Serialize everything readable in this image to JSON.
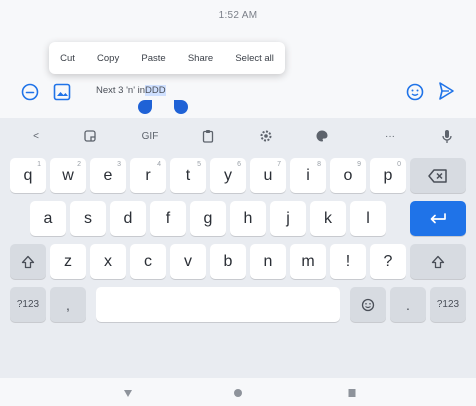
{
  "status": {
    "time": "1:52 AM"
  },
  "context_menu": {
    "items": [
      "Cut",
      "Copy",
      "Paste",
      "Share",
      "Select all"
    ]
  },
  "ghost_text": "",
  "compose": {
    "text_before": "Next 3 'n' in",
    "selected": "DDD",
    "text_after": ""
  },
  "toolbar": {
    "items": [
      {
        "name": "back-icon",
        "label": "<"
      },
      {
        "name": "sticker-icon",
        "label": ""
      },
      {
        "name": "gif-icon",
        "label": "GIF"
      },
      {
        "name": "clipboard-icon",
        "label": ""
      },
      {
        "name": "settings-icon",
        "label": ""
      },
      {
        "name": "palette-icon",
        "label": ""
      },
      {
        "name": "more-icon",
        "label": "···"
      },
      {
        "name": "mic-icon",
        "label": ""
      }
    ]
  },
  "keys": {
    "row1": [
      {
        "c": "q",
        "h": "1"
      },
      {
        "c": "w",
        "h": "2"
      },
      {
        "c": "e",
        "h": "3"
      },
      {
        "c": "r",
        "h": "4"
      },
      {
        "c": "t",
        "h": "5"
      },
      {
        "c": "y",
        "h": "6"
      },
      {
        "c": "u",
        "h": "7"
      },
      {
        "c": "i",
        "h": "8"
      },
      {
        "c": "o",
        "h": "9"
      },
      {
        "c": "p",
        "h": "0"
      }
    ],
    "row2": [
      "a",
      "s",
      "d",
      "f",
      "g",
      "h",
      "j",
      "k",
      "l"
    ],
    "row3": [
      "z",
      "x",
      "c",
      "v",
      "b",
      "n",
      "m",
      "!",
      "?"
    ],
    "symbols_label": "?123",
    "comma_label": ",",
    "period_label": ".",
    "right_symbols_label": "?123"
  },
  "colors": {
    "accent": "#1f73e8",
    "handle": "#1f62d6"
  }
}
